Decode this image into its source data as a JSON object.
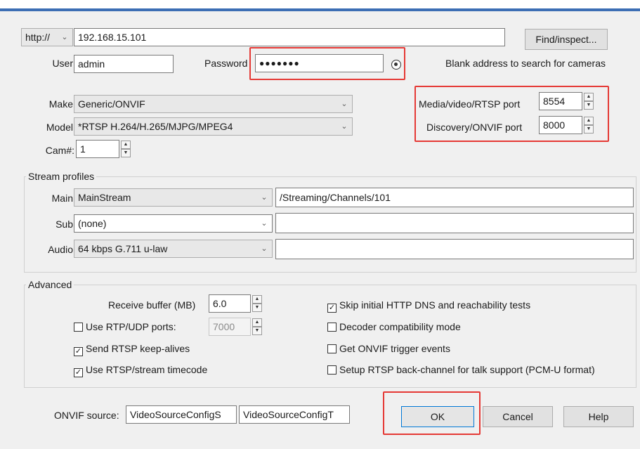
{
  "address": {
    "protocol": "http://",
    "value": "192.168.15.101",
    "find_button": "Find/inspect...",
    "hint": "Blank address to search for cameras"
  },
  "credentials": {
    "user_label": "User",
    "user_value": "admin",
    "password_label": "Password",
    "password_value": "●●●●●●●"
  },
  "device": {
    "make_label": "Make",
    "make_value": "Generic/ONVIF",
    "model_label": "Model",
    "model_value": "*RTSP H.264/H.265/MJPG/MPEG4",
    "cam_label": "Cam#:",
    "cam_value": "1"
  },
  "ports": {
    "media_label": "Media/video/RTSP port",
    "media_value": "8554",
    "discovery_label": "Discovery/ONVIF port",
    "discovery_value": "8000"
  },
  "stream_profiles": {
    "title": "Stream profiles",
    "main_label": "Main",
    "main_value": "MainStream",
    "main_path": "/Streaming/Channels/101",
    "sub_label": "Sub",
    "sub_value": "(none)",
    "sub_path": "",
    "audio_label": "Audio",
    "audio_value": "64 kbps G.711 u-law",
    "audio_path": ""
  },
  "advanced": {
    "title": "Advanced",
    "receive_buffer_label": "Receive buffer (MB)",
    "receive_buffer_value": "6.0",
    "use_rtp_udp_label": "Use RTP/UDP ports:",
    "use_rtp_udp_checked": false,
    "rtp_port_value": "7000",
    "send_keepalives_label": "Send RTSP keep-alives",
    "send_keepalives_checked": true,
    "use_timecode_label": "Use RTSP/stream timecode",
    "use_timecode_checked": true,
    "skip_dns_label": "Skip initial HTTP DNS and reachability tests",
    "skip_dns_checked": true,
    "decoder_compat_label": "Decoder compatibility mode",
    "decoder_compat_checked": false,
    "onvif_trigger_label": "Get ONVIF trigger events",
    "onvif_trigger_checked": false,
    "backchannel_label": "Setup RTSP back-channel for talk support (PCM-U format)",
    "backchannel_checked": false
  },
  "footer": {
    "onvif_source_label": "ONVIF source:",
    "onvif_source_1": "VideoSourceConfigS",
    "onvif_source_2": "VideoSourceConfigT",
    "ok_label": "OK",
    "cancel_label": "Cancel",
    "help_label": "Help"
  },
  "colors": {
    "highlight": "#e53935",
    "title_accent": "#3c6eb4"
  }
}
